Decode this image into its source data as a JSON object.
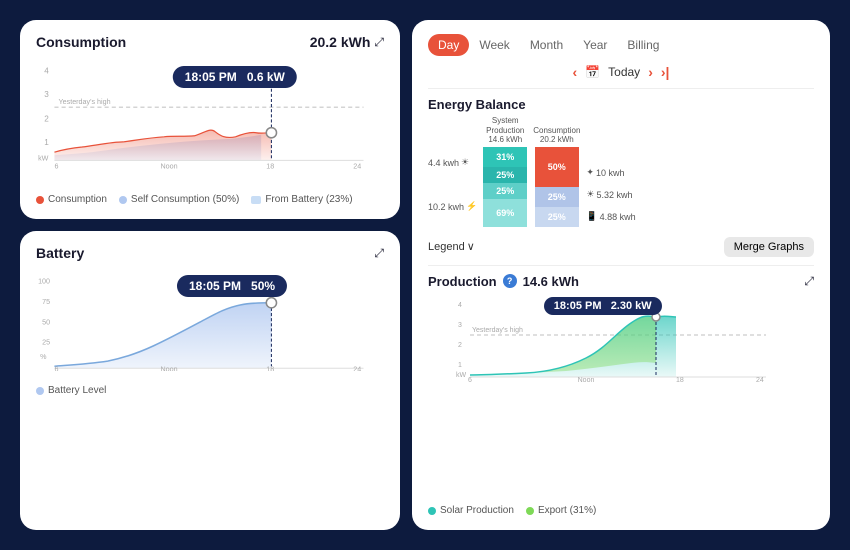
{
  "left": {
    "consumption": {
      "title": "Consumption",
      "value": "20.2 kWh",
      "expand": "⤢",
      "tooltip_time": "18:05 PM",
      "tooltip_value": "0.6 kW",
      "legend": [
        {
          "label": "Consumption",
          "color": "#e8523a",
          "type": "dot"
        },
        {
          "label": "Self Consumption (50%)",
          "color": "#b0c8f0",
          "type": "dot"
        },
        {
          "label": "From Battery (23%)",
          "color": "#c8ddf5",
          "type": "square"
        }
      ]
    },
    "battery": {
      "title": "Battery",
      "expand": "⤢",
      "tooltip_time": "18:05 PM",
      "tooltip_value": "50%",
      "legend": [
        {
          "label": "Battery Level",
          "color": "#b0c8f0",
          "type": "dot"
        }
      ]
    }
  },
  "right": {
    "tabs": [
      "Day",
      "Week",
      "Month",
      "Year",
      "Billing"
    ],
    "active_tab": "Day",
    "nav_label": "Today",
    "energy_balance": {
      "title": "Energy Balance",
      "bars": [
        {
          "label": "System\nProduction\n14.6 kWh",
          "segments": [
            {
              "color": "#2ec4b6",
              "height_pct": 31,
              "label": "31%"
            },
            {
              "color": "#2ec4b6",
              "height_pct": 25,
              "label": "25%"
            },
            {
              "color": "#2ec4b6",
              "height_pct": 25,
              "label": "25%"
            },
            {
              "color": "#2ec4b6",
              "height_pct": 19,
              "label": ""
            }
          ]
        },
        {
          "label": "Consumption\n20.2 kWh",
          "segments": [
            {
              "color": "#e8523a",
              "height_pct": 50,
              "label": "50%"
            },
            {
              "color": "#b0c4e8",
              "height_pct": 25,
              "label": "25%"
            },
            {
              "color": "#b0c4e8",
              "height_pct": 25,
              "label": "25%"
            }
          ]
        }
      ],
      "left_labels": [
        "4.4 kwh ☀",
        "10.2 kwh ⚡"
      ],
      "right_labels": [
        "✦ 10 kwh",
        "☀ 5.32 kwh",
        "📱 4.88 kwh"
      ],
      "bar_inner_labels": [
        "31%",
        "69%",
        "50%",
        "25%",
        "25%",
        "25%"
      ]
    },
    "legend_label": "Legend",
    "merge_btn": "Merge Graphs",
    "production": {
      "title": "Production",
      "value": "14.6 kWh",
      "expand": "⤢",
      "tooltip_time": "18:05 PM",
      "tooltip_value": "2.30 kW",
      "legend": [
        {
          "label": "Solar Production",
          "color": "#2ec4b6",
          "type": "dot"
        },
        {
          "label": "Export (31%)",
          "color": "#7ed957",
          "type": "dot"
        }
      ]
    }
  }
}
